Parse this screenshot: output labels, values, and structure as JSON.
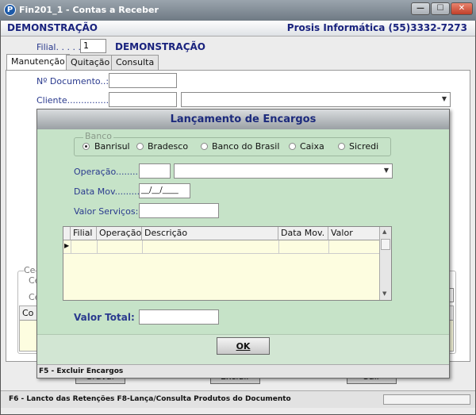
{
  "window": {
    "title": "Fin201_1 - Contas a Receber",
    "app_icon": "p-letter-icon",
    "buttons": {
      "minimize": "—",
      "maximize": "☐",
      "close": "✕"
    }
  },
  "header": {
    "company": "DEMONSTRAÇÃO",
    "vendor": "Prosis Informática (55)3332-7273"
  },
  "filial": {
    "label": "Filial. . . . . :",
    "value": "1",
    "name": "DEMONSTRAÇÃO"
  },
  "tabs": [
    {
      "label": "Manutenção",
      "active": true
    },
    {
      "label": "Quitação",
      "active": false
    },
    {
      "label": "Consulta",
      "active": false
    }
  ],
  "form": {
    "documento_label": "Nº Documento..:",
    "documento_value": "",
    "cliente_label": "Cliente.................:",
    "cliente_value": "",
    "cliente_name": ""
  },
  "background": {
    "group_label_partial": "Ce",
    "label_ce1": "Ce",
    "label_ce2": "Ce",
    "grid_col_partial": "Co",
    "gravar_label": "Gravar",
    "excluir_label": "Excluir",
    "sair_label": "Sair"
  },
  "modal": {
    "title": "Lançamento de Encargos",
    "banco": {
      "legend": "Banco",
      "options": [
        "Banrisul",
        "Bradesco",
        "Banco do Brasil",
        "Caixa",
        "Sicredi"
      ],
      "selected": "Banrisul"
    },
    "operacao_label": "Operação.........:",
    "operacao_code": "",
    "operacao_desc": "",
    "data_mov_label": "Data Mov..........:",
    "data_mov_value": "__/__/____",
    "valor_servicos_label": "Valor Serviços:",
    "valor_servicos_value": "",
    "grid": {
      "columns": [
        "Filial",
        "Operação",
        "Descrição",
        "Data Mov.",
        "Valor"
      ],
      "rows": []
    },
    "valor_total_label": "Valor Total:",
    "valor_total_value": "",
    "ok_label": "OK",
    "footer": "F5 - Excluir Encargos"
  },
  "statusbar": {
    "text": "F6 - Lancto das Retenções  F8-Lança/Consulta Produtos do Documento"
  },
  "colors": {
    "title_bar": "#6f7a84",
    "modal_bg": "#c6e3c8",
    "label_blue": "#2a3a8e",
    "grid_bg": "#fdfde0"
  }
}
